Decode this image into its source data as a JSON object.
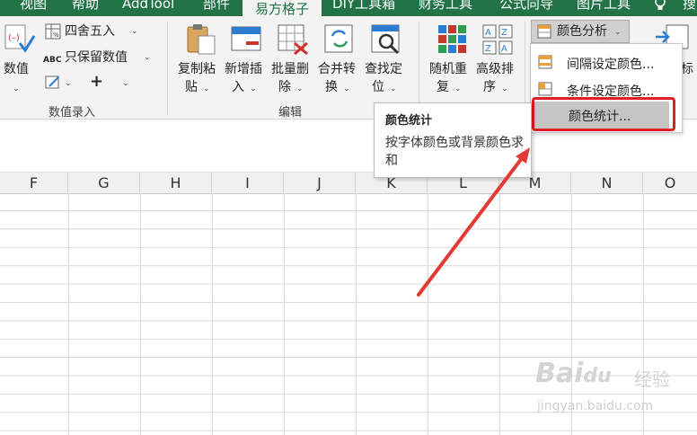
{
  "tabs": [
    "视图",
    "帮助",
    "AddTool",
    "部件",
    "易方格子",
    "DIY工具箱",
    "财务工具",
    "公式向导",
    "图片工具",
    "搜"
  ],
  "ribbon": {
    "value_group": {
      "big_button": "数值",
      "round_button": "四舍五入",
      "keep_value_button": "只保留数值",
      "plus": "+",
      "group_label": "数值录入"
    },
    "edit_group": {
      "buttons": [
        {
          "line1": "复制粘",
          "line2": "贴"
        },
        {
          "line1": "新增插",
          "line2": "入"
        },
        {
          "line1": "批量删",
          "line2": "除"
        },
        {
          "line1": "合并转",
          "line2": "换"
        },
        {
          "line1": "查找定",
          "line2": "位"
        }
      ],
      "group_label": "编辑"
    },
    "sort_group": {
      "buttons": [
        {
          "line1": "随机重",
          "line2": "复"
        },
        {
          "line1": "高级排",
          "line2": "序"
        }
      ]
    },
    "color_button": "颜色分析",
    "right_partial": "标"
  },
  "menu": {
    "items": [
      "间隔设定颜色...",
      "条件设定颜色...",
      "颜色统计..."
    ],
    "highlighted": "颜色统计..."
  },
  "tooltip": {
    "title": "颜色统计",
    "body": "按字体颜色或背景颜色求和"
  },
  "columns": [
    "F",
    "G",
    "H",
    "I",
    "J",
    "K",
    "L",
    "M",
    "N",
    "O"
  ],
  "watermark": {
    "logo": "Bai",
    "logo_mid": "du",
    "cn": "经验",
    "url": "jingyan.baidu.com"
  },
  "colors": {
    "excel_green": "#217346",
    "highlight": "#e02020"
  }
}
